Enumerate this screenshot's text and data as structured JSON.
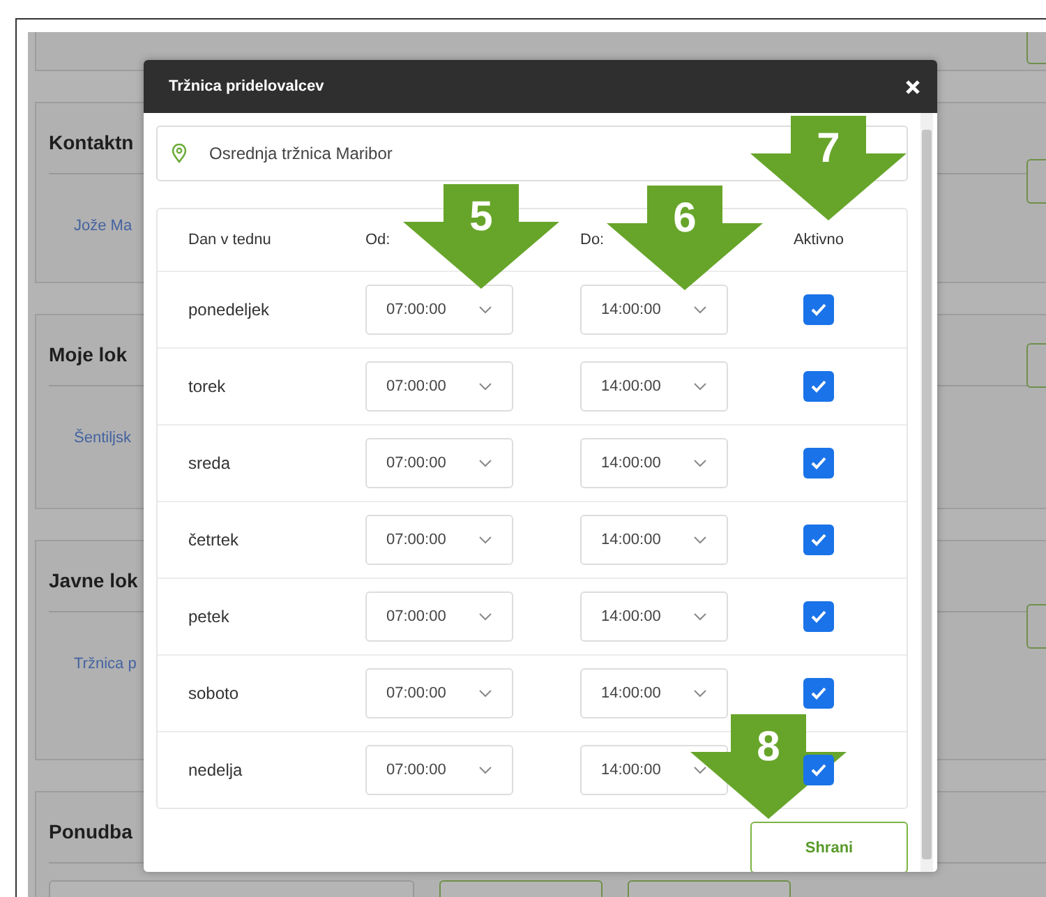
{
  "page": {
    "sections": [
      {
        "title": "Kontaktn",
        "link": "Jože Ma"
      },
      {
        "title": "Moje lok",
        "link": "Šentiljsk"
      },
      {
        "title": "Javne lok",
        "link": "Tržnica p"
      },
      {
        "title": "Ponudba"
      }
    ]
  },
  "dialog": {
    "title": "Tržnica pridelovalcev",
    "location": "Osrednja tržnica Maribor",
    "columns": [
      "Dan v tednu",
      "Od:",
      "Do:",
      "Aktivno"
    ],
    "rows": [
      {
        "day": "ponedeljek",
        "from": "07:00:00",
        "to": "14:00:00",
        "active": true
      },
      {
        "day": "torek",
        "from": "07:00:00",
        "to": "14:00:00",
        "active": true
      },
      {
        "day": "sreda",
        "from": "07:00:00",
        "to": "14:00:00",
        "active": true
      },
      {
        "day": "četrtek",
        "from": "07:00:00",
        "to": "14:00:00",
        "active": true
      },
      {
        "day": "petek",
        "from": "07:00:00",
        "to": "14:00:00",
        "active": true
      },
      {
        "day": "soboto",
        "from": "07:00:00",
        "to": "14:00:00",
        "active": true
      },
      {
        "day": "nedelja",
        "from": "07:00:00",
        "to": "14:00:00",
        "active": true
      }
    ],
    "save": "Shrani"
  },
  "annotations": [
    {
      "label": "5"
    },
    {
      "label": "6"
    },
    {
      "label": "7"
    },
    {
      "label": "8"
    }
  ]
}
